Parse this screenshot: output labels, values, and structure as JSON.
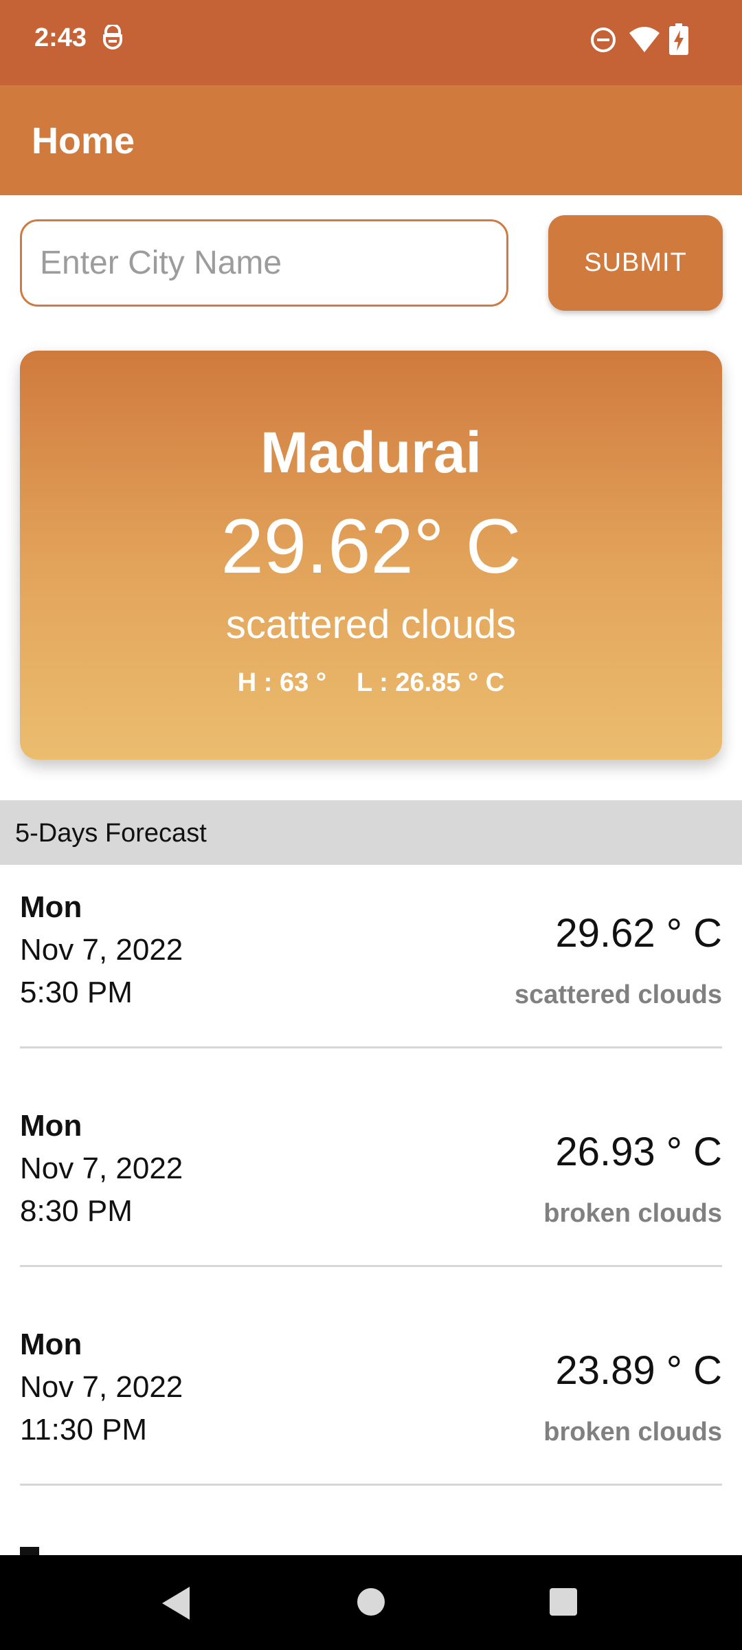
{
  "status_bar": {
    "time": "2:43",
    "icons": [
      "notification-icon",
      "do-not-disturb-icon",
      "wifi-icon",
      "battery-charging-icon"
    ]
  },
  "app_bar": {
    "title": "Home"
  },
  "search": {
    "placeholder": "Enter City Name",
    "value": "",
    "submit_label": "SUBMIT"
  },
  "current_weather": {
    "city": "Madurai",
    "temperature": "29.62° C",
    "description": "scattered clouds",
    "high": "H : 63 °",
    "low": "L : 26.85 ° C"
  },
  "forecast": {
    "header": "5-Days Forecast",
    "items": [
      {
        "day": "Mon",
        "date": "Nov 7, 2022",
        "time": "5:30 PM",
        "temp": "29.62 ° C",
        "desc": "scattered clouds"
      },
      {
        "day": "Mon",
        "date": "Nov 7, 2022",
        "time": "8:30 PM",
        "temp": "26.93 ° C",
        "desc": "broken clouds"
      },
      {
        "day": "Mon",
        "date": "Nov 7, 2022",
        "time": "11:30 PM",
        "temp": "23.89 ° C",
        "desc": "broken clouds"
      }
    ]
  },
  "nav_bar": {
    "icons": [
      "back-icon",
      "home-icon",
      "recents-icon"
    ]
  },
  "colors": {
    "status_bar": "#c56236",
    "primary": "#d07a3e",
    "card_gradient_top": "#d07a3e",
    "card_gradient_bottom": "#ebbd6f",
    "forecast_header_bg": "#d8d8d8",
    "muted_text": "#808080"
  }
}
